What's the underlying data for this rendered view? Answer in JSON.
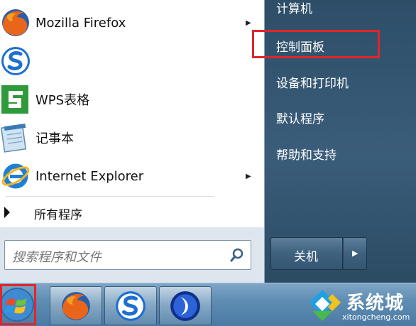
{
  "programs": [
    {
      "label": "Mozilla Firefox",
      "icon": "firefox-icon",
      "has_submenu": true
    },
    {
      "label": "",
      "icon": "sogou-icon",
      "has_submenu": false
    },
    {
      "label": "WPS表格",
      "icon": "wps-spreadsheet-icon",
      "has_submenu": false
    },
    {
      "label": "记事本",
      "icon": "notepad-icon",
      "has_submenu": false
    },
    {
      "label": "Internet Explorer",
      "icon": "internet-explorer-icon",
      "has_submenu": true
    }
  ],
  "all_programs_label": "所有程序",
  "search": {
    "placeholder": "搜索程序和文件"
  },
  "right_items": [
    {
      "label": "计算机"
    },
    {
      "label": "控制面板"
    },
    {
      "label": "设备和打印机"
    },
    {
      "label": "默认程序"
    },
    {
      "label": "帮助和支持"
    }
  ],
  "shutdown_label": "关机",
  "submenu_arrow": "▶",
  "watermark": {
    "title": "系统城",
    "subtitle": "xitongcheng.com"
  },
  "colors": {
    "highlight": "#e0262a",
    "right_panel": "#2e4e68",
    "taskbar": "#5f8db3"
  }
}
